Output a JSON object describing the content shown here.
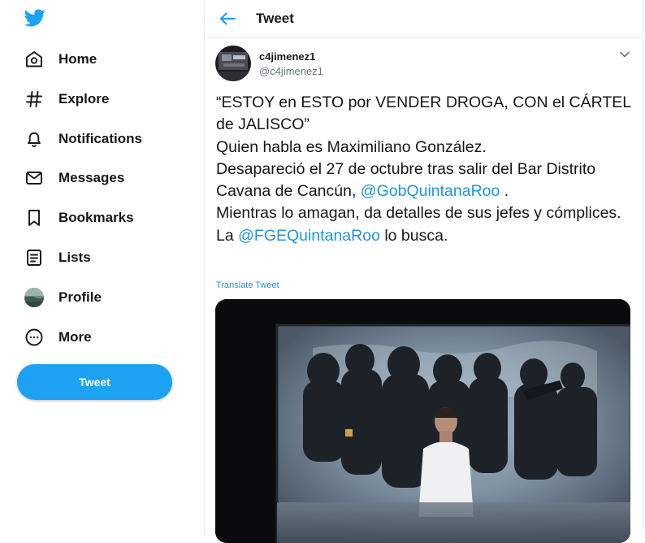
{
  "sidebar": {
    "logo": "twitter-bird-icon",
    "items": [
      {
        "label": "Home",
        "icon": "home-icon"
      },
      {
        "label": "Explore",
        "icon": "hashtag-icon"
      },
      {
        "label": "Notifications",
        "icon": "bell-icon"
      },
      {
        "label": "Messages",
        "icon": "envelope-icon"
      },
      {
        "label": "Bookmarks",
        "icon": "bookmark-icon"
      },
      {
        "label": "Lists",
        "icon": "list-icon"
      },
      {
        "label": "Profile",
        "icon": "avatar"
      },
      {
        "label": "More",
        "icon": "more-circle-icon"
      }
    ],
    "tweet_button": "Tweet"
  },
  "header": {
    "title": "Tweet",
    "back_icon": "back-arrow-icon"
  },
  "tweet": {
    "author_name": "c4jimenez1",
    "author_handle": "@c4jimenez1",
    "text": {
      "line1": "“ESTOY en ESTO por VENDER DROGA, CON el CÁRTEL de JALISCO”",
      "line2": "Quien habla es Maximiliano González.",
      "line3_pre": "Desapareció el 27 de octubre tras salir del Bar Distrito Cavana de Cancún, ",
      "mention1": "@GobQuintanaRoo",
      "line3_post": " .",
      "line4": "Mientras lo amagan, da detalles de sus jefes y cómplices.",
      "line5_pre": "La ",
      "mention2": "@FGEQuintanaRoo",
      "line5_post": " lo busca."
    },
    "translate_label": "Translate Tweet"
  },
  "colors": {
    "accent": "#1da1f2",
    "link": "#1b95e0",
    "border": "#e6ecf0",
    "secondary_text": "#657786"
  }
}
